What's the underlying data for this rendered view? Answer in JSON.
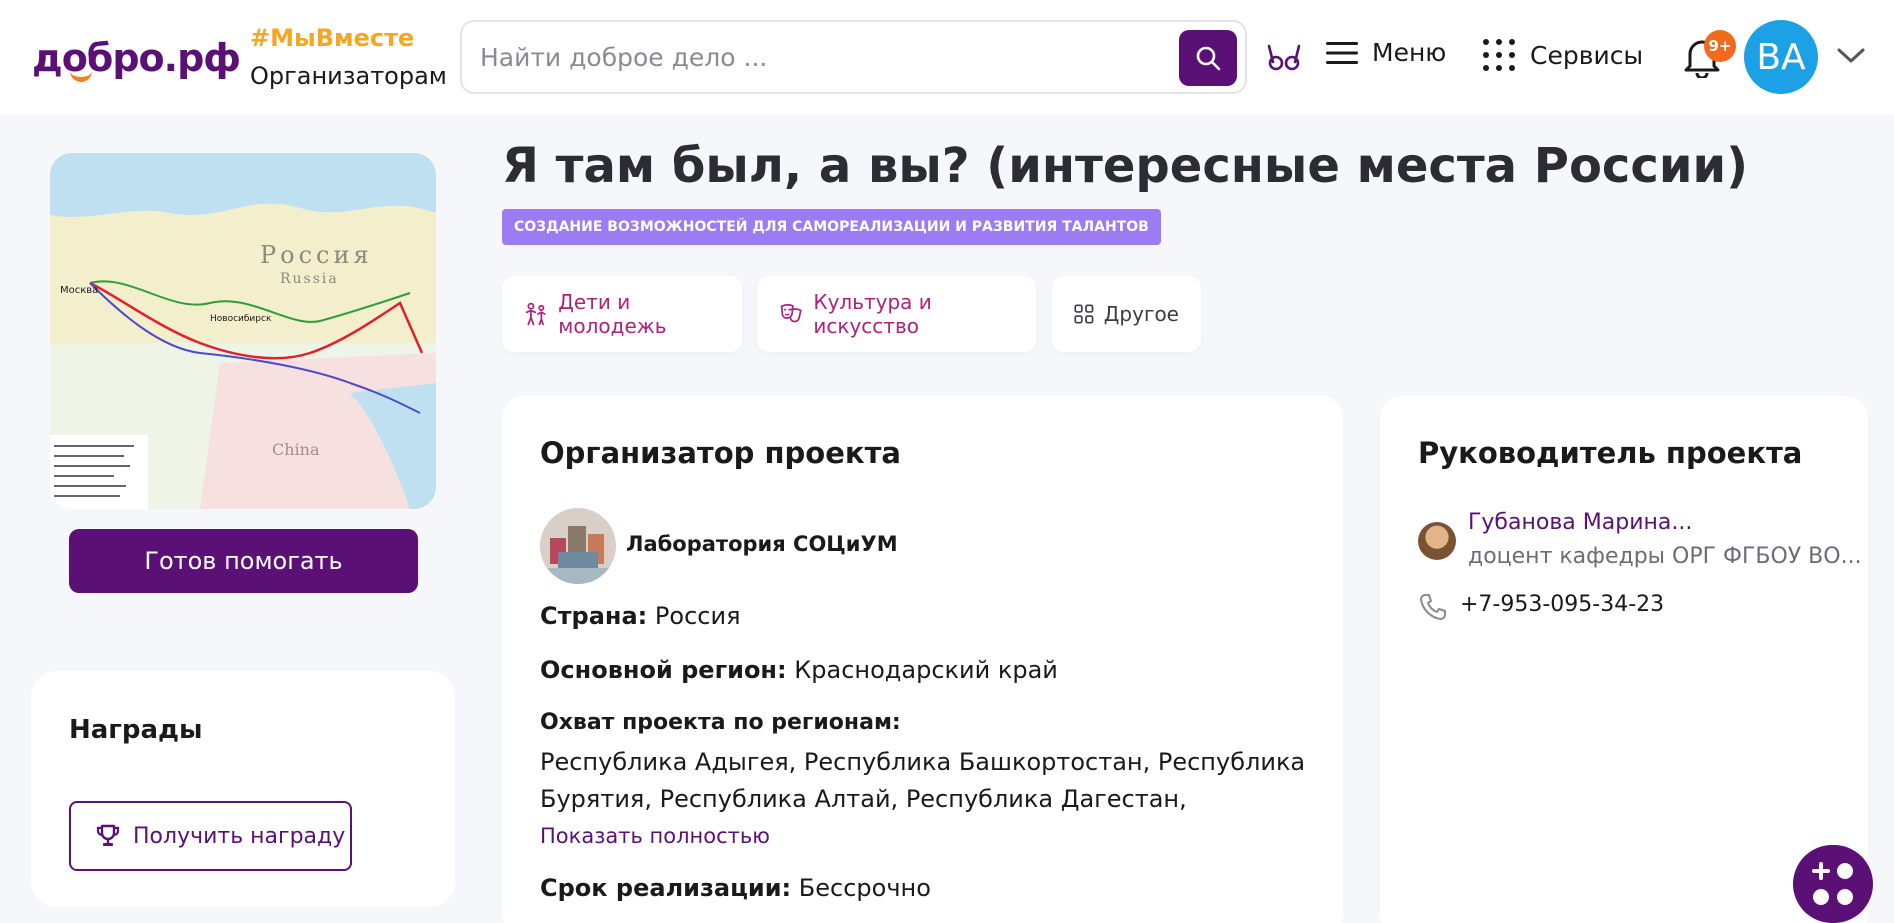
{
  "header": {
    "logo": "добро.рф",
    "hashtag": "#МыВместе",
    "organizers_link": "Организаторам",
    "search_placeholder": "Найти доброе дело ...",
    "menu_label": "Меню",
    "services_label": "Сервисы",
    "notifications_badge": "9+",
    "avatar_initials": "ВА"
  },
  "sidebar": {
    "map_labels": {
      "russia_ru": "Россия",
      "russia_en": "Russia",
      "moscow": "Москва",
      "novosibirsk": "Новосибирск",
      "china": "China"
    },
    "ready_button": "Готов помогать",
    "awards_title": "Награды",
    "get_award_button": "Получить награду"
  },
  "project": {
    "title": "Я там был, а вы? (интересные места России)",
    "category_badge": "СОЗДАНИЕ ВОЗМОЖНОСТЕЙ ДЛЯ САМОРЕАЛИЗАЦИИ И РАЗВИТИЯ ТАЛАНТОВ",
    "tags": [
      "Дети и молодежь",
      "Культура и искусство",
      "Другое"
    ]
  },
  "organizer": {
    "section_title": "Организатор проекта",
    "name": "Лаборатория СОЦиУМ",
    "country_label": "Страна:",
    "country_value": "Россия",
    "region_label": "Основной регион:",
    "region_value": "Краснодарский край",
    "coverage_label": "Охват проекта по регионам:",
    "coverage_value": "Республика Адыгея, Республика Башкортостан, Республика Бурятия, Республика Алтай, Республика Дагестан,",
    "show_more": "Показать полностью",
    "term_label": "Срок реализации:",
    "term_value": "Бессрочно"
  },
  "leader": {
    "section_title": "Руководитель проекта",
    "name": "Губанова Марина...",
    "position": "доцент кафедры ОРГ ФГБОУ ВО...",
    "phone": "+7-953-095-34-23"
  },
  "colors": {
    "brand_purple": "#5b1076",
    "accent_orange": "#f26b1d",
    "hashtag_yellow": "#f5a623",
    "badge_violet": "#9b7cf2",
    "avatar_blue": "#1da1e6"
  }
}
